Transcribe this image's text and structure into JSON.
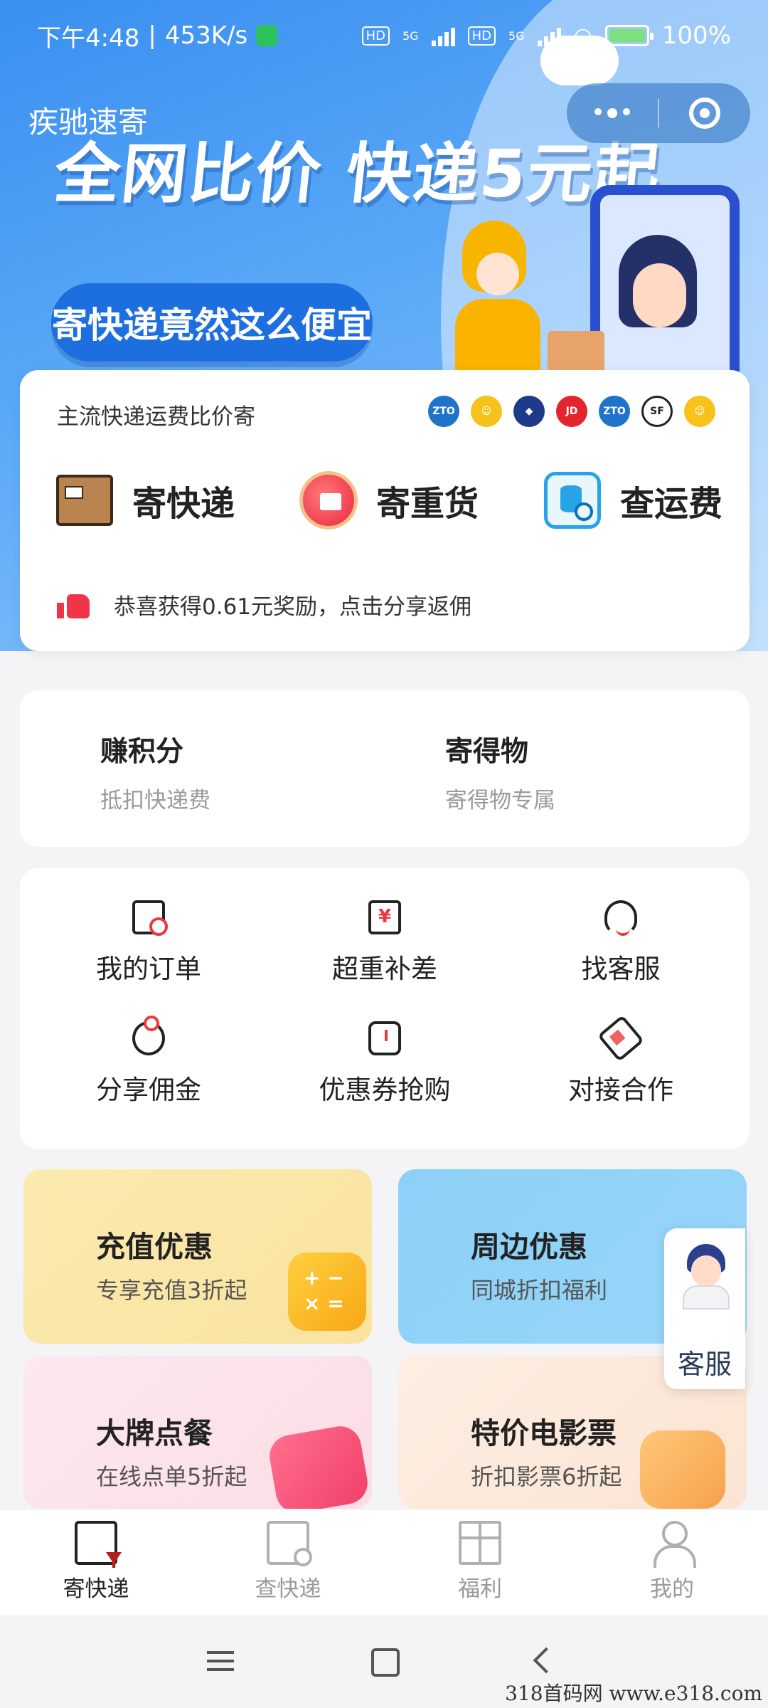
{
  "status_bar": {
    "time": "下午4:48",
    "speed": "453K/s",
    "sim1": "HD",
    "sim2": "HD",
    "net1": "5G",
    "net2": "5G",
    "battery": "100%"
  },
  "header": {
    "app_title": "疾驰速寄"
  },
  "banner": {
    "headline": "全网比价 快递5元起",
    "pill_text": "寄快递竟然这么便宜",
    "background_color": "#3a8ff0"
  },
  "main_card": {
    "subtitle": "主流快递运费比价寄",
    "carriers": [
      {
        "name": "ZTO",
        "color": "#1e74c8"
      },
      {
        "name": "smile",
        "color": "#f7c21c"
      },
      {
        "name": "yunda",
        "color": "#1e3a8a"
      },
      {
        "name": "JD",
        "color": "#e3252d"
      },
      {
        "name": "ZTO",
        "color": "#1e74c8"
      },
      {
        "name": "SF",
        "color": "#222222"
      },
      {
        "name": "smile",
        "color": "#f7c21c"
      }
    ],
    "services": [
      {
        "label": "寄快递",
        "icon": "parcel-box-icon"
      },
      {
        "label": "寄重货",
        "icon": "heavy-cargo-icon"
      },
      {
        "label": "查运费",
        "icon": "shipping-fee-icon"
      }
    ],
    "reward_text": "恭喜获得0.61元奖励，点击分享返佣"
  },
  "points_card": {
    "items": [
      {
        "title": "赚积分",
        "subtitle": "抵扣快递费"
      },
      {
        "title": "寄得物",
        "subtitle": "寄得物专属"
      }
    ]
  },
  "grid_menu": {
    "items": [
      {
        "label": "我的订单",
        "icon": "order-search-icon"
      },
      {
        "label": "超重补差",
        "icon": "overweight-yuan-icon"
      },
      {
        "label": "找客服",
        "icon": "headset-icon"
      },
      {
        "label": "分享佣金",
        "icon": "piggy-bank-icon"
      },
      {
        "label": "优惠券抢购",
        "icon": "coupon-icon"
      },
      {
        "label": "对接合作",
        "icon": "handshake-icon"
      }
    ]
  },
  "promos": [
    {
      "title": "充值优惠",
      "subtitle": "专享充值3折起"
    },
    {
      "title": "周边优惠",
      "subtitle": "同城折扣福利"
    },
    {
      "title": "大牌点餐",
      "subtitle": "在线点单5折起"
    },
    {
      "title": "特价电影票",
      "subtitle": "折扣影票6折起"
    }
  ],
  "customer_service_float": {
    "label": "客服"
  },
  "tab_bar": {
    "tabs": [
      {
        "label": "寄快递",
        "active": true
      },
      {
        "label": "查快递",
        "active": false
      },
      {
        "label": "福利",
        "active": false
      },
      {
        "label": "我的",
        "active": false
      }
    ]
  },
  "watermark": "318首码网   www.e318.com"
}
